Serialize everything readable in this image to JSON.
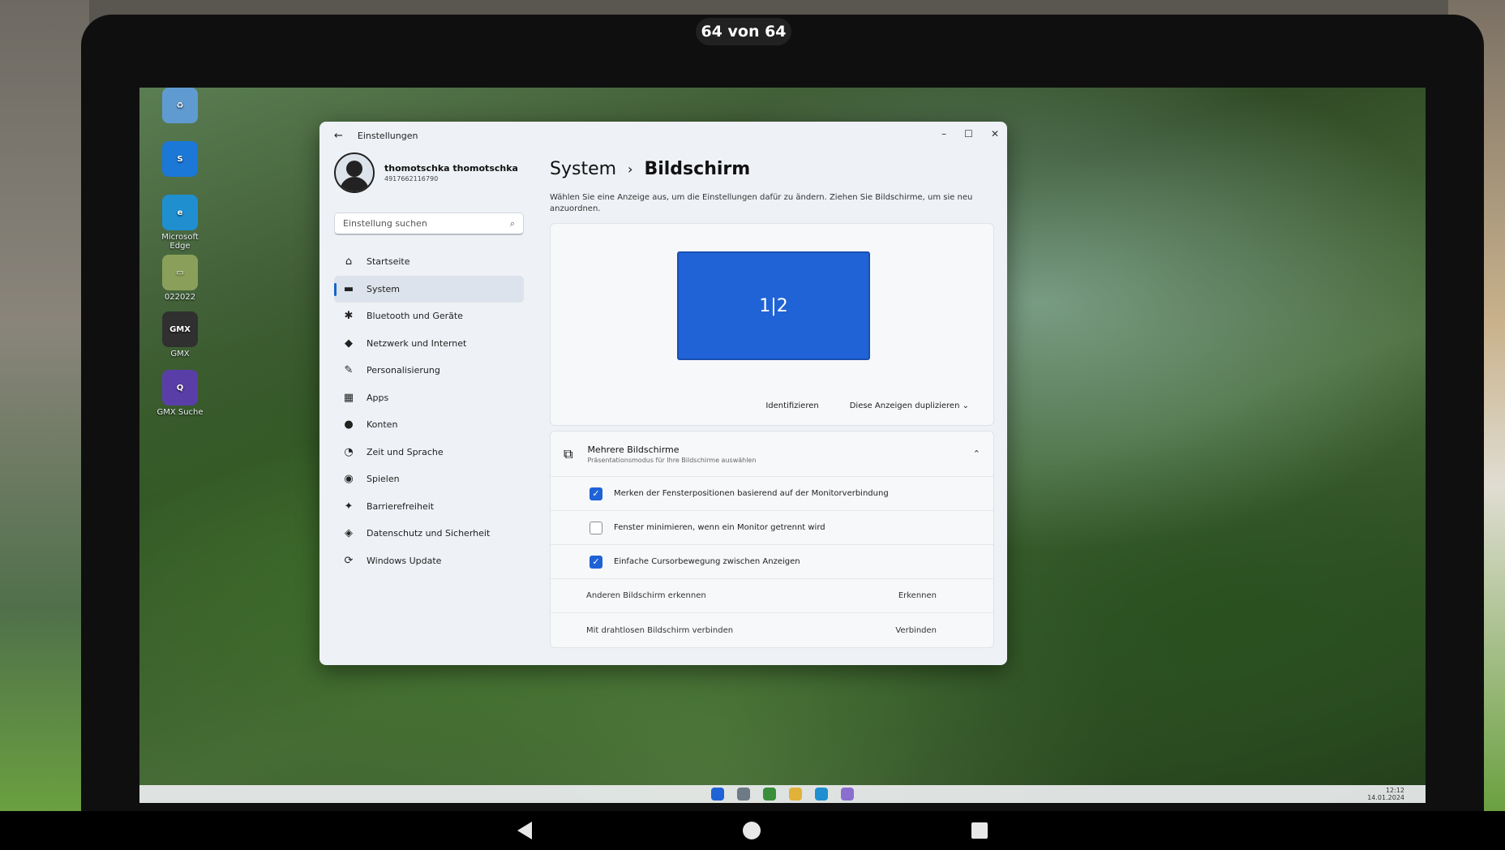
{
  "viewer": {
    "counter": "64 von 64"
  },
  "desktop": {
    "icons": [
      {
        "label": "",
        "glyph": "♻",
        "color": "#5f9bd1"
      },
      {
        "label": "",
        "glyph": "S",
        "color": "#1b78d6"
      },
      {
        "label": "Microsoft Edge",
        "glyph": "e",
        "color": "#1f8fd0"
      },
      {
        "label": "022022",
        "glyph": "▭",
        "color": "#8aa05a"
      },
      {
        "label": "GMX",
        "glyph": "GMX",
        "color": "#303030"
      },
      {
        "label": "GMX Suche",
        "glyph": "Q",
        "color": "#5a3ea8"
      }
    ],
    "taskbar": {
      "time": "12:12",
      "date": "14.01.2024"
    }
  },
  "window": {
    "title": "Einstellungen",
    "profile": {
      "name": "thomotschka thomotschka",
      "id": "4917662116790"
    },
    "search_placeholder": "Einstellung suchen",
    "nav": [
      {
        "label": "Startseite",
        "icon": "home-icon",
        "glyph": "⌂",
        "active": false
      },
      {
        "label": "System",
        "icon": "system-icon",
        "glyph": "▬",
        "active": true
      },
      {
        "label": "Bluetooth und Geräte",
        "icon": "bluetooth-icon",
        "glyph": "✱",
        "active": false
      },
      {
        "label": "Netzwerk und Internet",
        "icon": "network-icon",
        "glyph": "◆",
        "active": false
      },
      {
        "label": "Personalisierung",
        "icon": "brush-icon",
        "glyph": "✎",
        "active": false
      },
      {
        "label": "Apps",
        "icon": "apps-icon",
        "glyph": "▦",
        "active": false
      },
      {
        "label": "Konten",
        "icon": "account-icon",
        "glyph": "●",
        "active": false
      },
      {
        "label": "Zeit und Sprache",
        "icon": "globe-clock-icon",
        "glyph": "◔",
        "active": false
      },
      {
        "label": "Spielen",
        "icon": "gamepad-icon",
        "glyph": "◉",
        "active": false
      },
      {
        "label": "Barrierefreiheit",
        "icon": "accessibility-icon",
        "glyph": "✦",
        "active": false
      },
      {
        "label": "Datenschutz und Sicherheit",
        "icon": "shield-icon",
        "glyph": "◈",
        "active": false
      },
      {
        "label": "Windows Update",
        "icon": "update-icon",
        "glyph": "⟳",
        "active": false
      }
    ],
    "breadcrumb": {
      "parent": "System",
      "current": "Bildschirm"
    },
    "description": "Wählen Sie eine Anzeige aus, um die Einstellungen dafür zu ändern. Ziehen Sie Bildschirme, um sie neu anzuordnen.",
    "display": {
      "monitor_label": "1|2",
      "identify_label": "Identifizieren",
      "mode_label": "Diese Anzeigen duplizieren"
    },
    "multi": {
      "title": "Mehrere Bildschirme",
      "subtitle": "Präsentationsmodus für Ihre Bildschirme auswählen",
      "options": [
        {
          "label": "Merken der Fensterpositionen basierend auf der Monitorverbindung",
          "checked": true
        },
        {
          "label": "Fenster minimieren, wenn ein Monitor getrennt wird",
          "checked": false
        },
        {
          "label": "Einfache Cursorbewegung zwischen Anzeigen",
          "checked": true
        }
      ],
      "actions": [
        {
          "label": "Anderen Bildschirm erkennen",
          "button": "Erkennen"
        },
        {
          "label": "Mit drahtlosen Bildschirm verbinden",
          "button": "Verbinden"
        }
      ]
    }
  }
}
